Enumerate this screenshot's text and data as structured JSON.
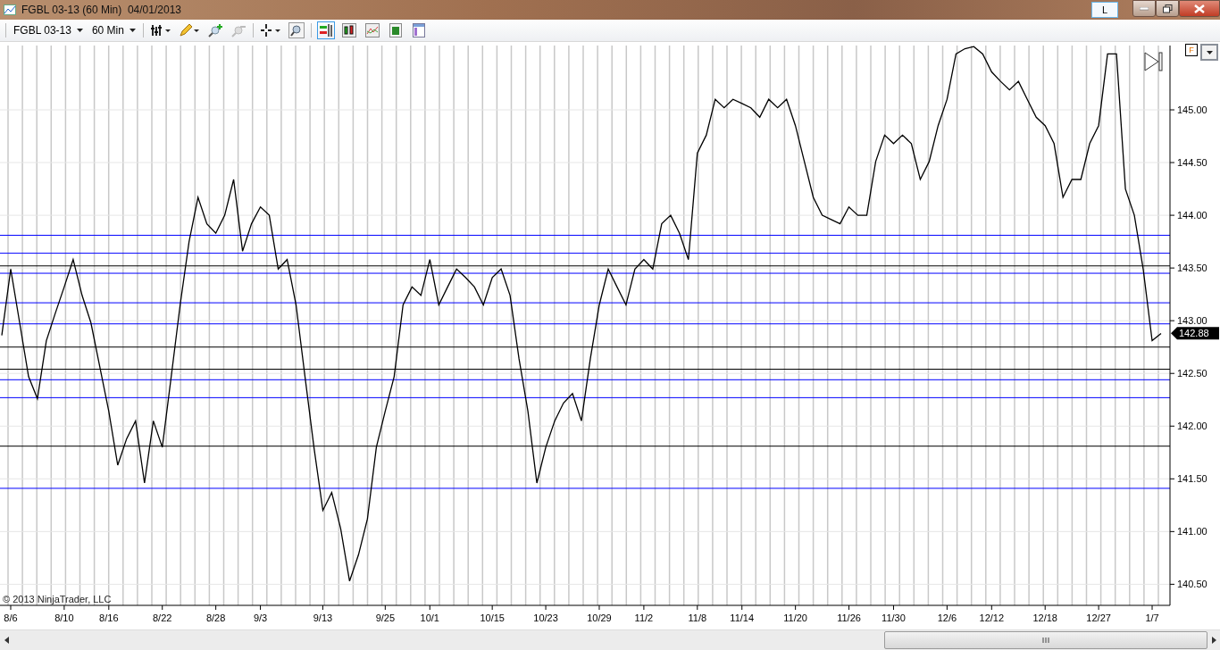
{
  "window": {
    "title": "FGBL 03-13 (60 Min)  04/01/2013",
    "link_button": "L"
  },
  "toolbar": {
    "instrument": "FGBL 03-13",
    "interval": "60 Min"
  },
  "chart": {
    "flag": "F",
    "copyright": "© 2013 NinjaTrader, LLC",
    "last_price": "142.88",
    "chart_data": {
      "type": "line",
      "grid": true,
      "ylim": [
        140.3,
        145.61
      ],
      "categories": [
        null,
        "8/6",
        null,
        null,
        null,
        null,
        null,
        "8/10",
        null,
        null,
        null,
        null,
        "8/16",
        null,
        null,
        null,
        null,
        null,
        "8/22",
        null,
        null,
        null,
        null,
        null,
        "8/28",
        null,
        null,
        null,
        null,
        "9/3",
        null,
        null,
        null,
        null,
        null,
        null,
        "9/13",
        null,
        null,
        null,
        null,
        null,
        null,
        "9/25",
        null,
        null,
        null,
        null,
        "10/1",
        null,
        null,
        null,
        null,
        null,
        null,
        "10/15",
        null,
        null,
        null,
        null,
        null,
        "10/23",
        null,
        null,
        null,
        null,
        null,
        "10/29",
        null,
        null,
        null,
        null,
        "11/2",
        null,
        null,
        null,
        null,
        null,
        "11/8",
        null,
        null,
        null,
        null,
        "11/14",
        null,
        null,
        null,
        null,
        null,
        "11/20",
        null,
        null,
        null,
        null,
        null,
        "11/26",
        null,
        null,
        null,
        null,
        "11/30",
        null,
        null,
        null,
        null,
        null,
        "12/6",
        null,
        null,
        null,
        null,
        "12/12",
        null,
        null,
        null,
        null,
        null,
        "12/18",
        null,
        null,
        null,
        null,
        null,
        "12/27",
        null,
        null,
        null,
        null,
        null,
        "1/7",
        null
      ],
      "yticks": [
        {
          "value": 140.5,
          "label": "140.50"
        },
        {
          "value": 141,
          "label": "141.00"
        },
        {
          "value": 141.5,
          "label": "141.50"
        },
        {
          "value": 142,
          "label": "142.00"
        },
        {
          "value": 142.5,
          "label": "142.50"
        },
        {
          "value": 143,
          "label": "143.00"
        },
        {
          "value": 143.5,
          "label": "143.50"
        },
        {
          "value": 144,
          "label": "144.00"
        },
        {
          "value": 144.5,
          "label": "144.50"
        },
        {
          "value": 145,
          "label": "145.00"
        }
      ],
      "series": [
        {
          "color": "#000000",
          "values": [
            142.86,
            143.49,
            142.98,
            142.47,
            142.26,
            142.81,
            143.07,
            143.32,
            143.58,
            143.24,
            142.98,
            142.56,
            142.14,
            141.63,
            141.88,
            142.05,
            141.46,
            142.05,
            141.8,
            142.47,
            143.15,
            143.75,
            144.17,
            143.92,
            143.83,
            144.0,
            144.34,
            143.66,
            143.92,
            144.08,
            144.0,
            143.49,
            143.58,
            143.15,
            142.47,
            141.8,
            141.2,
            141.37,
            141.03,
            140.53,
            140.78,
            141.12,
            141.8,
            142.14,
            142.47,
            143.15,
            143.32,
            143.24,
            143.58,
            143.15,
            143.32,
            143.49,
            143.41,
            143.32,
            143.15,
            143.41,
            143.49,
            143.24,
            142.64,
            142.14,
            141.46,
            141.8,
            142.05,
            142.22,
            142.31,
            142.05,
            142.64,
            143.15,
            143.49,
            143.32,
            143.15,
            143.49,
            143.58,
            143.49,
            143.92,
            144.0,
            143.83,
            143.58,
            144.59,
            144.76,
            145.1,
            145.02,
            145.1,
            145.06,
            145.02,
            144.93,
            145.1,
            145.02,
            145.1,
            144.85,
            144.51,
            144.17,
            144.0,
            143.96,
            143.92,
            144.08,
            144.0,
            144.0,
            144.51,
            144.76,
            144.68,
            144.76,
            144.68,
            144.34,
            144.51,
            144.85,
            145.1,
            145.53,
            145.58,
            145.6,
            145.53,
            145.36,
            145.27,
            145.19,
            145.27,
            145.1,
            144.93,
            144.85,
            144.68,
            144.17,
            144.34,
            144.34,
            144.68,
            144.85,
            145.53,
            145.53,
            144.25,
            144.0,
            143.49,
            142.81,
            142.88
          ]
        }
      ],
      "ref_lines": [
        {
          "axis": "y",
          "value": 143.81,
          "color": "#0000ff"
        },
        {
          "axis": "y",
          "value": 143.64,
          "color": "#0000ff"
        },
        {
          "axis": "y",
          "value": 143.52,
          "color": "#000000"
        },
        {
          "axis": "y",
          "value": 143.45,
          "color": "#0000ff"
        },
        {
          "axis": "y",
          "value": 143.17,
          "color": "#0000ff"
        },
        {
          "axis": "y",
          "value": 142.97,
          "color": "#0000ff"
        },
        {
          "axis": "y",
          "value": 142.75,
          "color": "#000000"
        },
        {
          "axis": "y",
          "value": 142.54,
          "color": "#000000"
        },
        {
          "axis": "y",
          "value": 142.44,
          "color": "#0000ff"
        },
        {
          "axis": "y",
          "value": 142.27,
          "color": "#0000ff"
        },
        {
          "axis": "y",
          "value": 141.81,
          "color": "#000000"
        },
        {
          "axis": "y",
          "value": 141.41,
          "color": "#0000ff"
        }
      ]
    }
  }
}
